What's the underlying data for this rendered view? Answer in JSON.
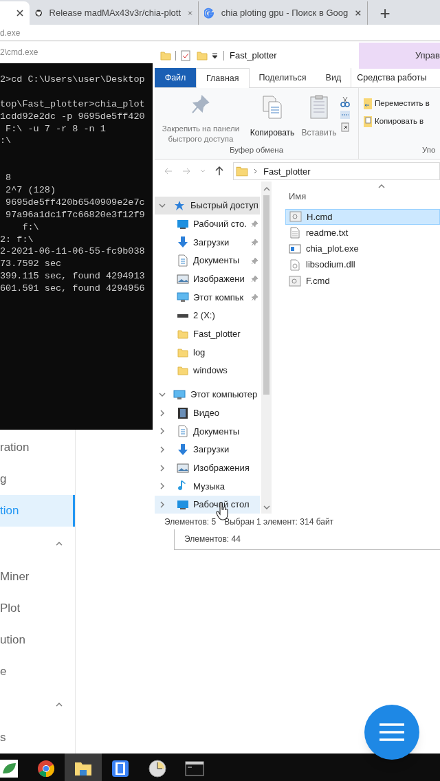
{
  "browser": {
    "tabs": [
      {
        "kind": "partial",
        "selected": true
      },
      {
        "kind": "github",
        "title": "Release madMAx43v3r/chia-plott",
        "selected": false
      },
      {
        "kind": "google",
        "title": "chia ploting gpu - Поиск в Goog",
        "selected": false
      }
    ],
    "new_tab": "+"
  },
  "back_window_title": "d.exe",
  "cmd": {
    "title": "2\\cmd.exe",
    "lines": [
      {
        "kind": "text",
        "text": "2>cd C:\\Users\\user\\Desktop"
      },
      {
        "kind": "blank"
      },
      {
        "kind": "text",
        "text": "top\\Fast_plotter>chia_plot"
      },
      {
        "kind": "text",
        "text": "1cdd92e2dc -p 9695de5ff420"
      },
      {
        "kind": "text",
        "text": " F:\\ -u 7 -r 8 -n 1"
      },
      {
        "kind": "text",
        "text": ":\\"
      },
      {
        "kind": "blank"
      },
      {
        "kind": "blank"
      },
      {
        "kind": "text",
        "text": " 8"
      },
      {
        "kind": "text",
        "text": " 2^7 (128)"
      },
      {
        "kind": "text",
        "text": " 9695de5ff420b6540909e2e7c"
      },
      {
        "kind": "text",
        "text": " 97a96a1dc1f7c66820e3f12f9"
      },
      {
        "kind": "text",
        "text": "    f:\\"
      },
      {
        "kind": "text",
        "text": "2: f:\\"
      },
      {
        "kind": "text",
        "text": "2-2021-06-11-06-55-fc9b038"
      },
      {
        "kind": "text",
        "text": "73.7592 sec"
      },
      {
        "kind": "text",
        "text": "399.115 sec, found 4294913"
      },
      {
        "kind": "text",
        "text": "601.591 sec, found 4294956"
      }
    ]
  },
  "web_sidebar": {
    "items": [
      {
        "kind": "link",
        "label": "ration",
        "selected": false
      },
      {
        "kind": "link",
        "label": "g",
        "selected": false
      },
      {
        "kind": "link",
        "label": "tion",
        "selected": true
      },
      {
        "kind": "section",
        "expanded": true
      },
      {
        "kind": "link",
        "label": "Miner",
        "selected": false
      },
      {
        "kind": "link",
        "label": "Plot",
        "selected": false
      },
      {
        "kind": "link",
        "label": "ution",
        "selected": false
      },
      {
        "kind": "link",
        "label": "e",
        "selected": false
      },
      {
        "kind": "section",
        "expanded": true
      },
      {
        "kind": "link",
        "label": "s",
        "selected": false
      }
    ]
  },
  "explorer": {
    "title": "Fast_plotter",
    "context_tab": "Управ",
    "ribbon_tabs": [
      {
        "kind": "file",
        "label": "Файл"
      },
      {
        "kind": "tab",
        "label": "Главная",
        "selected": true
      },
      {
        "kind": "tab",
        "label": "Поделиться",
        "selected": false
      },
      {
        "kind": "tab",
        "label": "Вид",
        "selected": false
      },
      {
        "kind": "context",
        "label": "Средства работы"
      }
    ],
    "clipboard": {
      "pin": "Закрепить на панели быстрого доступа",
      "copy": "Копировать",
      "paste": "Вставить",
      "group": "Буфер обмена"
    },
    "organize": {
      "move": "Переместить в",
      "copy_to": "Копировать в",
      "group": "Упо"
    },
    "address": "Fast_plotter",
    "nav": [
      {
        "kind": "star",
        "label": "Быстрый доступ",
        "expanded": true,
        "selected": true,
        "children": [
          {
            "kind": "desktop",
            "label": "Рабочий сто.",
            "pinned": true,
            "selected": false
          },
          {
            "kind": "download",
            "label": "Загрузки",
            "pinned": true,
            "selected": false
          },
          {
            "kind": "document",
            "label": "Документы",
            "pinned": true,
            "selected": false
          },
          {
            "kind": "picture",
            "label": "Изображени",
            "pinned": true,
            "selected": false
          },
          {
            "kind": "computer",
            "label": "Этот компьк",
            "pinned": true,
            "selected": false
          },
          {
            "kind": "drive",
            "label": "2 (X:)",
            "pinned": false,
            "selected": false
          },
          {
            "kind": "folder",
            "label": "Fast_plotter",
            "pinned": false,
            "selected": false
          },
          {
            "kind": "folder",
            "label": "log",
            "pinned": false,
            "selected": false
          },
          {
            "kind": "folder",
            "label": "windows",
            "pinned": false,
            "selected": false
          }
        ]
      },
      {
        "kind": "computer",
        "label": "Этот компьютер",
        "expanded": true,
        "selected": false,
        "children": [
          {
            "kind": "video",
            "label": "Видео",
            "expanded": false,
            "selected": false
          },
          {
            "kind": "document",
            "label": "Документы",
            "expanded": false,
            "selected": false
          },
          {
            "kind": "download",
            "label": "Загрузки",
            "expanded": false,
            "selected": false
          },
          {
            "kind": "picture",
            "label": "Изображения",
            "expanded": false,
            "selected": false
          },
          {
            "kind": "music",
            "label": "Музыка",
            "expanded": false,
            "selected": false
          },
          {
            "kind": "desktop",
            "label": "Рабочий стол",
            "expanded": false,
            "selected": true
          }
        ]
      }
    ],
    "column": "Имя",
    "files": [
      {
        "kind": "cmd",
        "name": "H.cmd",
        "selected": true
      },
      {
        "kind": "txt",
        "name": "readme.txt",
        "selected": false
      },
      {
        "kind": "exe",
        "name": "chia_plot.exe",
        "selected": false
      },
      {
        "kind": "dll",
        "name": "libsodium.dll",
        "selected": false
      },
      {
        "kind": "cmd",
        "name": "F.cmd",
        "selected": false
      }
    ],
    "status_count": "Элементов: 5",
    "status_selection": "Выбран 1 элемент: 314 байт"
  },
  "back_explorer_status": "Элементов: 44",
  "taskbar": {
    "apps": [
      {
        "kind": "leaf",
        "active": false
      },
      {
        "kind": "chrome",
        "active": false
      },
      {
        "kind": "explorer",
        "active": true
      },
      {
        "kind": "floppy",
        "active": false
      },
      {
        "kind": "clock",
        "active": false
      },
      {
        "kind": "console",
        "active": false
      }
    ]
  }
}
